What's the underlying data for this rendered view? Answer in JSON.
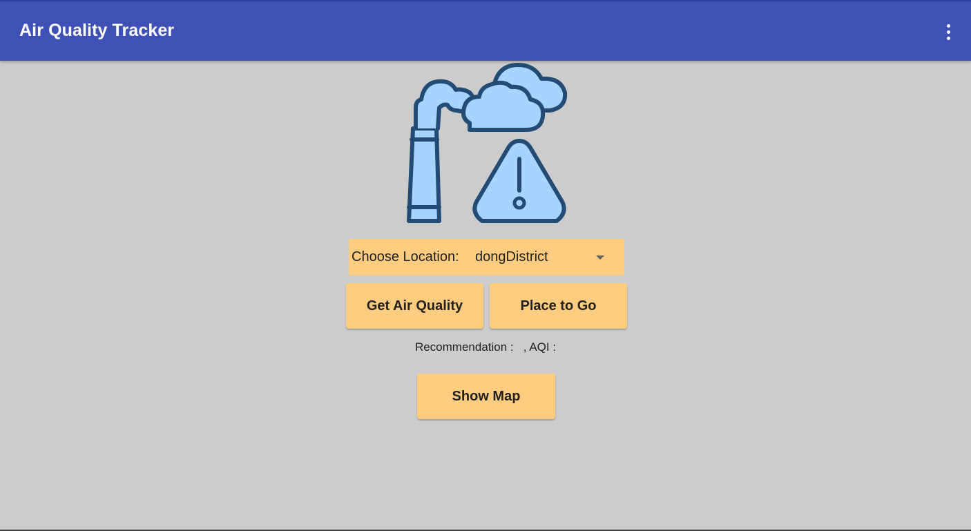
{
  "app_bar": {
    "title": "Air Quality Tracker",
    "overflow_icon": "more-vert-icon",
    "color": "#3f51b5"
  },
  "hero": {
    "icon": "factory-pollution-warning-icon",
    "fill_color": "#a7d3ff",
    "stroke_color": "#244b73"
  },
  "location": {
    "label": "Choose Location:",
    "selected": "dongDistrict"
  },
  "buttons": {
    "get_air_quality": "Get Air Quality",
    "place_to_go": "Place to Go",
    "show_map": "Show Map",
    "color": "#ffcc80"
  },
  "result": {
    "text": "Recommendation :   , AQI :"
  },
  "background_color": "#cccccc"
}
